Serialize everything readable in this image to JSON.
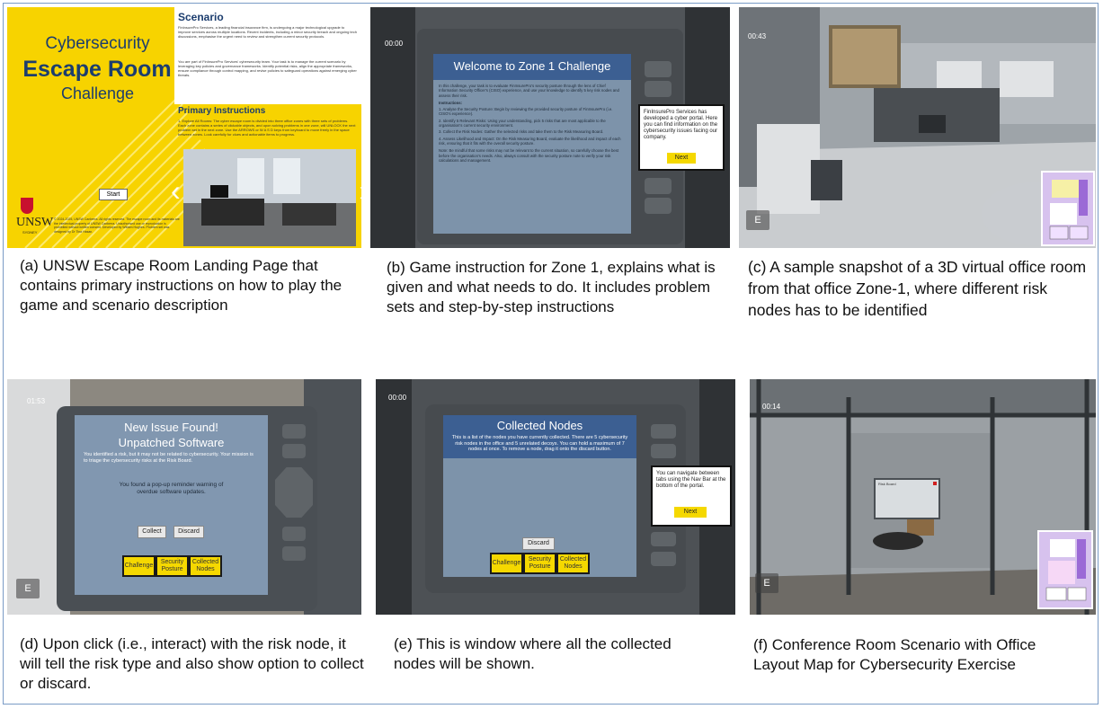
{
  "panel_a": {
    "title_line1": "Cybersecurity",
    "title_line2": "Escape Room",
    "title_line3": "Challenge",
    "scenario_heading": "Scenario",
    "scenario_p1": "FinInsurePro Services, a leading financial insurance firm, is undergoing a major technological upgrade to improve services across multiple locations. Recent incidents, including a minor security breach and ongoing tech discussions, emphasise the urgent need to review and strengthen current security protocols.",
    "scenario_p2": "You are part of FinInsurePro Services' cybersecurity team. Your task is to manage the current scenario by leveraging key policies and governance frameworks. Identify potential risks, align the appropriate frameworks, ensure compliance through control mapping, and revise policies to safeguard operations against emerging cyber threats.",
    "instructions_heading": "Primary Instructions",
    "instructions_p": "1. Explore All Rooms: The cyber escape room is divided into three office zones with three sets of problems. Each zone contains a series of clickable objects, and upon solving problems in one zone, will UNLOCK the next problem set in the next zone. Use the ARROWS or W A S D keys from keyboard to move freely in the space between zones. Look carefully for clues and actionable items to progress.",
    "start_label": "Start",
    "logo_text": "UNSW",
    "logo_sub": "SYDNEY",
    "copyright": "© 2024-2025, UNSW Canberra. All rights reserved. The escape room and its materials are the intellectual property of UNSW Canberra. Unauthorised use or reproduction is prohibited without written consent. Developed by William Hughes. Problem set was designed by Dr Tina Hasan.",
    "prev_arrow": "‹",
    "next_arrow": "›"
  },
  "panel_b": {
    "timer": "00:00",
    "dialog_title": "Welcome to Zone 1 Challenge",
    "intro": "In this challenge, your task is to evaluate FinInsurePro's security posture through the lens of Chief Information Security Officer's (CISO) experience, and use your knowledge to identify 5 key risk nodes and assess their risk.",
    "instructions_label": "Instructions:",
    "step1": "1. Analyse the Security Posture: Begin by reviewing the provided security posture of FinInsurePro (i.e. CISO's experience).",
    "step2": "2. Identify 5 Relevant Risks: Using your understanding, pick 5 risks that are most applicable to the organisation's current security environment.",
    "step3": "3. Collect the Risk Nodes: Gather the selected risks and take them to the Risk Measuring Board.",
    "step4": "4. Assess Likelihood and Impact: On the Risk Measuring Board, evaluate the likelihood and impact of each risk, ensuring that it fits with the overall security posture.",
    "note": "Note: Be mindful that some risks may not be relevant to the current situation, so carefully choose the best before the organisation's needs. Also, always consult with the security posture note to verify your risk calculations and management.",
    "popup_text": "FinInsurePro Services has developed a cyber portal. Here you can find information on the cybersecurity issues facing our company.",
    "next_label": "Next"
  },
  "panel_c": {
    "timer": "00:43",
    "e_key": "E"
  },
  "panel_d": {
    "timer": "01:53",
    "title_line1": "New Issue Found!",
    "title_line2": "Unpatched Software",
    "desc": "You identified a risk, but it may not be related to cybersecurity. Your mission is to triage the cybersecurity risks at the Risk Board.",
    "finding": "You found a pop-up reminder warning of overdue software updates.",
    "collect_label": "Collect",
    "discard_label": "Discard",
    "tab1": "Challenge",
    "tab2": "Security Posture",
    "tab3": "Collected Nodes",
    "e_key": "E"
  },
  "panel_e": {
    "timer": "00:00",
    "title": "Collected Nodes",
    "desc": "This is a list of the nodes you have currently collected. There are 5 cybersecurity risk nodes in the office and 5 unrelated decoys. You can hold a maximum of 7 nodes at once. To remove a node, drag it onto the discard button.",
    "popup_text": "You can navigate between tabs using the Nav Bar at the bottom of the portal.",
    "next_label": "Next",
    "discard_label": "Discard",
    "tab1": "Challenge",
    "tab2": "Security Posture",
    "tab3": "Collected Nodes"
  },
  "panel_f": {
    "timer": "00:14",
    "board_title": "Risk Board",
    "e_key": "E"
  },
  "captions": {
    "a": "(a) UNSW Escape Room Landing Page that contains primary instructions on how to play the game and scenario description",
    "b": "(b) Game instruction for Zone 1, explains what is given and what needs to do. It includes problem sets and step-by-step instructions",
    "c": "(c) A sample snapshot of a 3D virtual office room from that office Zone-1, where different risk nodes has to be identified",
    "d": "(d) Upon click (i.e., interact) with the risk node, it will tell the risk type and also show option to collect or discard.",
    "e": "(e) This is window where all the collected nodes will be shown.",
    "f": "(f)  Conference Room Scenario with Office Layout Map for Cybersecurity Exercise"
  },
  "colors": {
    "yellow": "#f7d300",
    "dialog_blue": "#3c5f92",
    "dialog_body": "#7d93aa",
    "frame_grey": "#4a4f54",
    "minimap": "#d7c2ee"
  }
}
